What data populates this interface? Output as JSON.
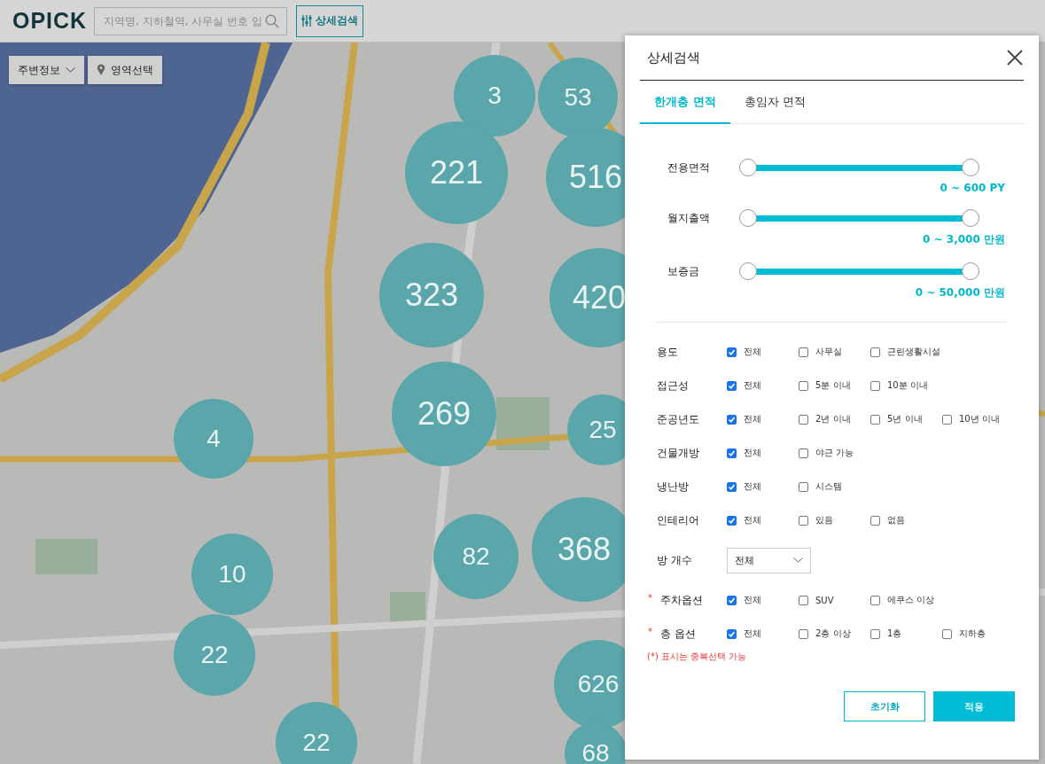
{
  "header": {
    "logo": "OPICK",
    "search": {
      "placeholder": "지역명, 지하철역, 사무실 번호 입"
    },
    "detail_button": "상세검색"
  },
  "map_controls": {
    "nearby_dropdown": "주변정보",
    "area_button": "영역선택"
  },
  "map": {
    "kind": "picture",
    "clusters": [
      {
        "count": "3"
      },
      {
        "count": "53"
      },
      {
        "count": "221"
      },
      {
        "count": "516"
      },
      {
        "count": "323"
      },
      {
        "count": "420"
      },
      {
        "count": "4"
      },
      {
        "count": "269"
      },
      {
        "count": "25"
      },
      {
        "count": "82"
      },
      {
        "count": "368"
      },
      {
        "count": "10"
      },
      {
        "count": "22"
      },
      {
        "count": "626"
      },
      {
        "count": "22"
      },
      {
        "count": "68"
      }
    ]
  },
  "dialog": {
    "title": "상세검색",
    "tabs": [
      {
        "label": "한개층 면적",
        "selected": true
      },
      {
        "label": "총임자 면적",
        "selected": false
      }
    ],
    "sliders": [
      {
        "label": "전용면적",
        "level": 1,
        "reading": "0 ~ 600 PY"
      },
      {
        "label": "월지출액",
        "level": 1,
        "reading": "0 ~ 3,000 만원"
      },
      {
        "label": "보증금",
        "level": 1,
        "reading": "0 ~ 50,000 만원"
      }
    ],
    "filters": [
      {
        "kind": "checks",
        "label": "용도",
        "options": [
          {
            "label": "전체",
            "checked": true
          },
          {
            "label": "사무실",
            "checked": false
          },
          {
            "label": "근린생활시설",
            "checked": false
          }
        ]
      },
      {
        "kind": "checks",
        "label": "접근성",
        "options": [
          {
            "label": "전체",
            "checked": true
          },
          {
            "label": "5분 이내",
            "checked": false
          },
          {
            "label": "10분 이내",
            "checked": false
          }
        ]
      },
      {
        "kind": "checks",
        "label": "준공년도",
        "options": [
          {
            "label": "전체",
            "checked": true
          },
          {
            "label": "2년 이내",
            "checked": false
          },
          {
            "label": "5년 이내",
            "checked": false
          },
          {
            "label": "10년 이내",
            "checked": false
          }
        ]
      },
      {
        "kind": "checks",
        "label": "건물개방",
        "options": [
          {
            "label": "전체",
            "checked": true
          },
          {
            "label": "야근 가능",
            "checked": false
          }
        ]
      },
      {
        "kind": "checks",
        "label": "냉난방",
        "options": [
          {
            "label": "전체",
            "checked": true
          },
          {
            "label": "시스템",
            "checked": false
          }
        ]
      },
      {
        "kind": "checks",
        "label": "인테리어",
        "options": [
          {
            "label": "전체",
            "checked": true
          },
          {
            "label": "있음",
            "checked": false
          },
          {
            "label": "없음",
            "checked": false
          }
        ]
      },
      {
        "kind": "select",
        "label": "방 개수",
        "value": "전체"
      },
      {
        "kind": "checks",
        "marker": "*",
        "label": "주차옵션",
        "options": [
          {
            "label": "전체",
            "checked": true
          },
          {
            "label": "SUV",
            "checked": false
          },
          {
            "label": "에쿠스 이상",
            "checked": false
          }
        ]
      },
      {
        "kind": "checks",
        "marker": "*",
        "label": "층 옵션",
        "options": [
          {
            "label": "전체",
            "checked": true
          },
          {
            "label": "2층 이상",
            "checked": false
          },
          {
            "label": "1층",
            "checked": false
          },
          {
            "label": "지하층",
            "checked": false
          }
        ]
      }
    ],
    "note": "(*) 표시는 중복선택 가능",
    "buttons": [
      {
        "kind": "secondary",
        "label": "초기화"
      },
      {
        "kind": "primary",
        "label": "적용"
      }
    ]
  }
}
